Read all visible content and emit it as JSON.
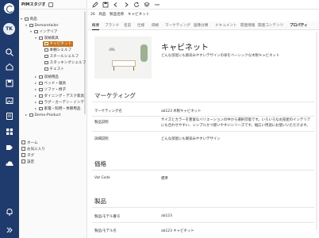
{
  "rail": {
    "avatar": "TK",
    "icons": [
      "logo-icon",
      "search-icon",
      "home-icon",
      "save-icon",
      "image-icon",
      "clipboard-icon",
      "grid-icon",
      "tag-icon",
      "cloud-icon",
      "bell-icon",
      "expand-icon"
    ]
  },
  "tree": {
    "header": "PIMスタジオ",
    "nodes": [
      {
        "label": "商品",
        "arrow": "▾"
      },
      {
        "label": "Demoretailer",
        "arrow": "▾"
      },
      {
        "label": "インテリア",
        "arrow": "▾"
      },
      {
        "label": "収納家具",
        "arrow": "▾"
      },
      {
        "label": "キャビネット",
        "arrow": ""
      },
      {
        "label": "本棚シェルフ",
        "arrow": ""
      },
      {
        "label": "スチールシェルフ",
        "arrow": ""
      },
      {
        "label": "スタッキングシェルフ",
        "arrow": ""
      },
      {
        "label": "チェスト",
        "arrow": ""
      },
      {
        "label": "収納用品",
        "arrow": "▸"
      },
      {
        "label": "ベッド・寝具",
        "arrow": "▸"
      },
      {
        "label": "ソファ・椅子",
        "arrow": "▸"
      },
      {
        "label": "ダイニング・デスク家具",
        "arrow": "▸"
      },
      {
        "label": "ラグ・カーテン・インテ",
        "arrow": "▸"
      },
      {
        "label": "家電・照明・季節用品",
        "arrow": "▸"
      },
      {
        "label": "Demo-Product",
        "arrow": "▸"
      }
    ],
    "footer": [
      {
        "label": "ホーム"
      },
      {
        "label": "お気に入り"
      },
      {
        "label": "タグ"
      },
      {
        "label": "設定"
      }
    ]
  },
  "toolbar": {
    "icons": [
      "edit-icon",
      "save-icon",
      "back-icon",
      "forward-icon",
      "refresh-icon",
      "layers-icon",
      "more-icon"
    ]
  },
  "crumb": {
    "id": "26",
    "status": "商品",
    "kind": "製品名称",
    "name": "キャビネット"
  },
  "tabs": [
    "概要",
    "ブランド",
    "名前",
    "仕様",
    "価格",
    "マーケティング",
    "画像分類",
    "ドキュメント",
    "関連情報",
    "関連コンテンツ",
    "プロパティ"
  ],
  "product": {
    "title": "キャビネット",
    "desc": "どんな部屋にも馴染みやすいデザインの扉をベーシックな木製キャビネット"
  },
  "marketing": {
    "title": "マーケティング",
    "rows": [
      {
        "label": "マーケティング名",
        "value": "ab123 木製キャビネット"
      },
      {
        "label": "製品説明",
        "value": "サイズとカラーを豊富なバリエーションの中から選択可能です。いろいろなお部屋のインテリアにも合わせやすい、シンプルかつ使いやすいシリーズです。幅広い用途にお使いいただけます。"
      },
      {
        "label": "詳細説明",
        "value": "どんな部屋にも馴染みやすいデザイン"
      }
    ]
  },
  "price": {
    "title": "価格",
    "rows": [
      {
        "label": "Vat Code",
        "value": "標準"
      }
    ]
  },
  "product_sec": {
    "title": "製品",
    "rows": [
      {
        "label": "製品/モデル番号",
        "value": "ab123"
      },
      {
        "label": "製品/モデル名",
        "value": "ab123 キャビネット"
      }
    ]
  },
  "colors": {
    "rail": "#1f3a6d",
    "accent": "#c9741a"
  }
}
